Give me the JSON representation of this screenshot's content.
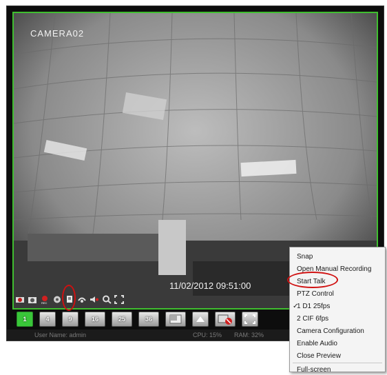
{
  "camera": {
    "name": "CAMERA02",
    "timestamp": "11/02/2012 09:51:00"
  },
  "toolbar": {
    "icons": [
      "camera-off-icon",
      "snapshot-icon",
      "record-icon",
      "ptz-icon",
      "talk-icon",
      "audio-icon",
      "volume-icon",
      "zoom-icon",
      "fullscreen-icon"
    ]
  },
  "layout_buttons": [
    "1",
    "4",
    "9",
    "16",
    "25",
    "36"
  ],
  "status": {
    "user": "User Name: admin",
    "cpu": "CPU: 15%",
    "ram": "RAM: 32%"
  },
  "context_menu": {
    "items": [
      {
        "label": "Snap"
      },
      {
        "label": "Open Manual Recording"
      },
      {
        "label": "Start Talk"
      },
      {
        "label": "PTZ Control"
      },
      {
        "label": "1 D1 25fps",
        "checked": true
      },
      {
        "label": "2 CIF 6fps"
      },
      {
        "label": "Camera Configuration"
      },
      {
        "label": "Enable Audio"
      },
      {
        "label": "Close Preview"
      },
      {
        "label": "Full-screen"
      }
    ]
  },
  "colors": {
    "active_border": "#3fbf2f",
    "highlight": "#d01010"
  }
}
